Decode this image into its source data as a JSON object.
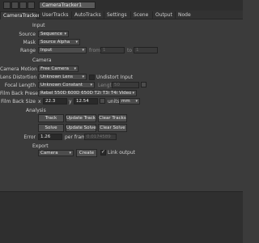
{
  "window": {
    "title": "CameraTracker1"
  },
  "tabs": [
    {
      "label": "CameraTracker"
    },
    {
      "label": "UserTracks"
    },
    {
      "label": "AutoTracks"
    },
    {
      "label": "Settings"
    },
    {
      "label": "Scene"
    },
    {
      "label": "Output"
    },
    {
      "label": "Node"
    }
  ],
  "input": {
    "section": "Input",
    "source_label": "Source",
    "source_value": "Sequence",
    "mask_label": "Mask",
    "mask_value": "Source Alpha",
    "range_label": "Range",
    "range_value": "Input",
    "from_label": "from",
    "from_value": "1",
    "to_label": "to",
    "to_value": "1"
  },
  "camera": {
    "section": "Camera",
    "motion_label": "Camera Motion",
    "motion_value": "Free Camera",
    "lens_label": "Lens Distortion",
    "lens_value": "Unknown Lens",
    "undistort_label": "Undistort Input",
    "focal_label": "Focal Length",
    "focal_value": "Unknown Constant",
    "length_label": "Length",
    "length_value": "50",
    "filmback_preset_label": "Film Back Preset",
    "filmback_preset_value": "Rebel 550D 600D 650D T2i T3i T4i Video",
    "filmback_size_label": "Film Back Size",
    "fb_x_label": "x",
    "fb_x_value": "22.3",
    "fb_y_label": "y",
    "fb_y_value": "12.54",
    "units_label": "units",
    "units_value": "mm"
  },
  "analysis": {
    "section": "Analysis",
    "track": "Track",
    "update_track": "Update Track",
    "clear_tracks": "Clear Tracks",
    "solve": "Solve",
    "update_solve": "Update Solve",
    "clear_solve": "Clear Solve",
    "error_label": "Error",
    "error_value": "1.26",
    "per_frame_label": "per frame",
    "per_frame_value": "0.0174589"
  },
  "export": {
    "section": "Export",
    "export_value": "Camera",
    "create": "Create",
    "link_label": "Link output"
  }
}
